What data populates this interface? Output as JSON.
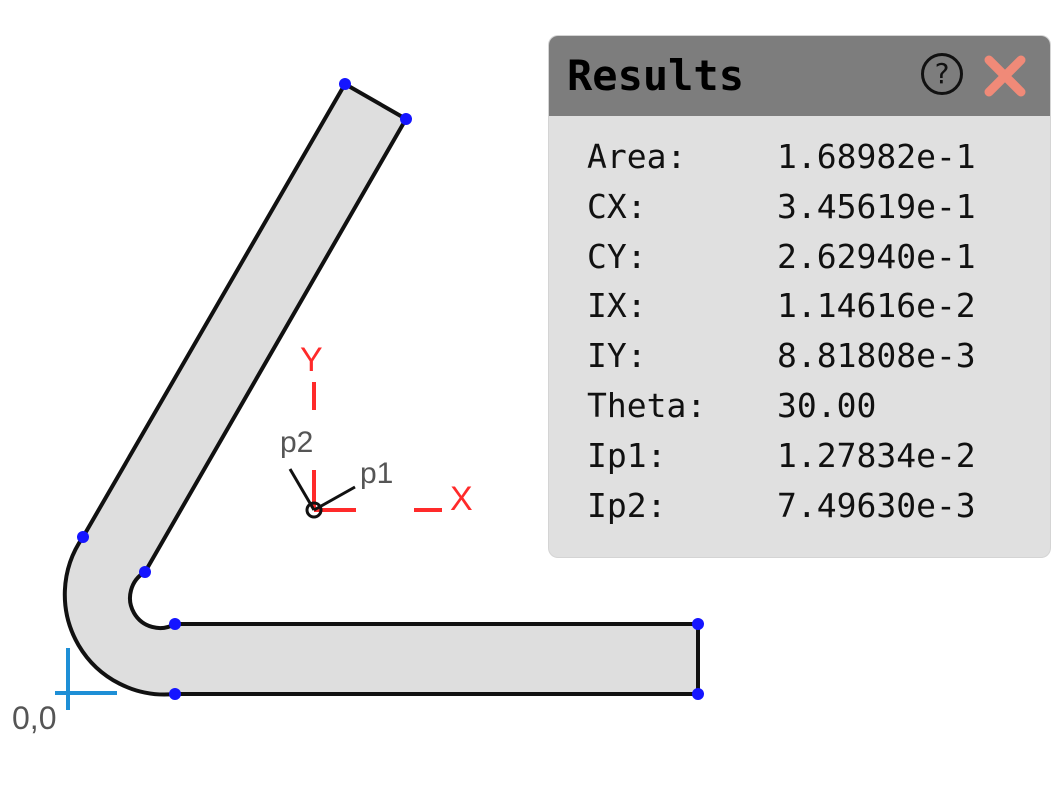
{
  "canvas": {
    "origin_label": "0,0",
    "axis_x_label": "X",
    "axis_y_label": "Y",
    "principal_axis_1_label": "p1",
    "principal_axis_2_label": "p2",
    "colors": {
      "shape_fill": "#dedede",
      "shape_outline": "#111111",
      "vertex": "#1515ff",
      "centroid_axes": "#ff2a2a",
      "origin_axes": "#1e8fd6"
    }
  },
  "results": {
    "title": "Results",
    "help_icon": "question-circle-icon",
    "close_icon": "close-x-icon",
    "colors": {
      "header": "#7d7d7d",
      "body": "#e0e0e0",
      "close": "#f08a78"
    },
    "rows": [
      {
        "label": "Area:",
        "value": "1.68982e-1"
      },
      {
        "label": "CX:",
        "value": "3.45619e-1"
      },
      {
        "label": "CY:",
        "value": "2.62940e-1"
      },
      {
        "label": "IX:",
        "value": "1.14616e-2"
      },
      {
        "label": "IY:",
        "value": "8.81808e-3"
      },
      {
        "label": "Theta:",
        "value": "30.00"
      },
      {
        "label": "Ip1:",
        "value": "1.27834e-2"
      },
      {
        "label": "Ip2:",
        "value": "7.49630e-3"
      }
    ]
  }
}
